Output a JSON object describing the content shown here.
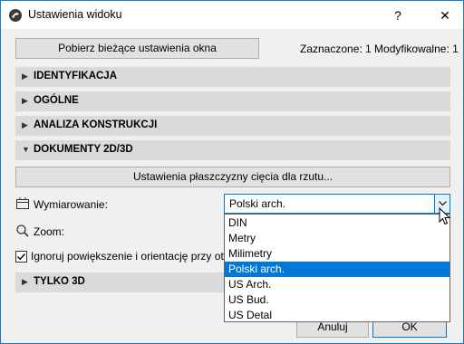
{
  "window": {
    "title": "Ustawienia widoku",
    "help": "?",
    "close": "✕"
  },
  "toolbar": {
    "get_settings_label": "Pobierz bieżące ustawienia okna",
    "selection_info": "Zaznaczone: 1 Modyfikowalne: 1"
  },
  "sections": [
    {
      "label": "IDENTYFIKACJA",
      "expanded": false
    },
    {
      "label": "OGÓLNE",
      "expanded": false
    },
    {
      "label": "ANALIZA KONSTRUKCJI",
      "expanded": false
    },
    {
      "label": "DOKUMENTY 2D/3D",
      "expanded": true
    },
    {
      "label": "TYLKO 3D",
      "expanded": false
    }
  ],
  "documents": {
    "plane_button_label": "Ustawienia płaszczyzny cięcia dla rzutu...",
    "dimensioning_label": "Wymiarowanie:",
    "zoom_label": "Zoom:",
    "ignore_zoom_label": "Ignoruj powiększenie i orientację przy otwieraniu",
    "ignore_zoom_checked": true,
    "dimensioning_value": "Polski arch.",
    "dimensioning_options": [
      "DIN",
      "Metry",
      "Milimetry",
      "Polski arch.",
      "US Arch.",
      "US Bud.",
      "US Detal"
    ],
    "selected_index": 3
  },
  "footer": {
    "cancel_label": "Anuluj",
    "ok_label": "OK"
  },
  "colors": {
    "accent": "#0078d7",
    "section_bg": "#dadada",
    "dialog_bg": "#f0f0f0"
  }
}
